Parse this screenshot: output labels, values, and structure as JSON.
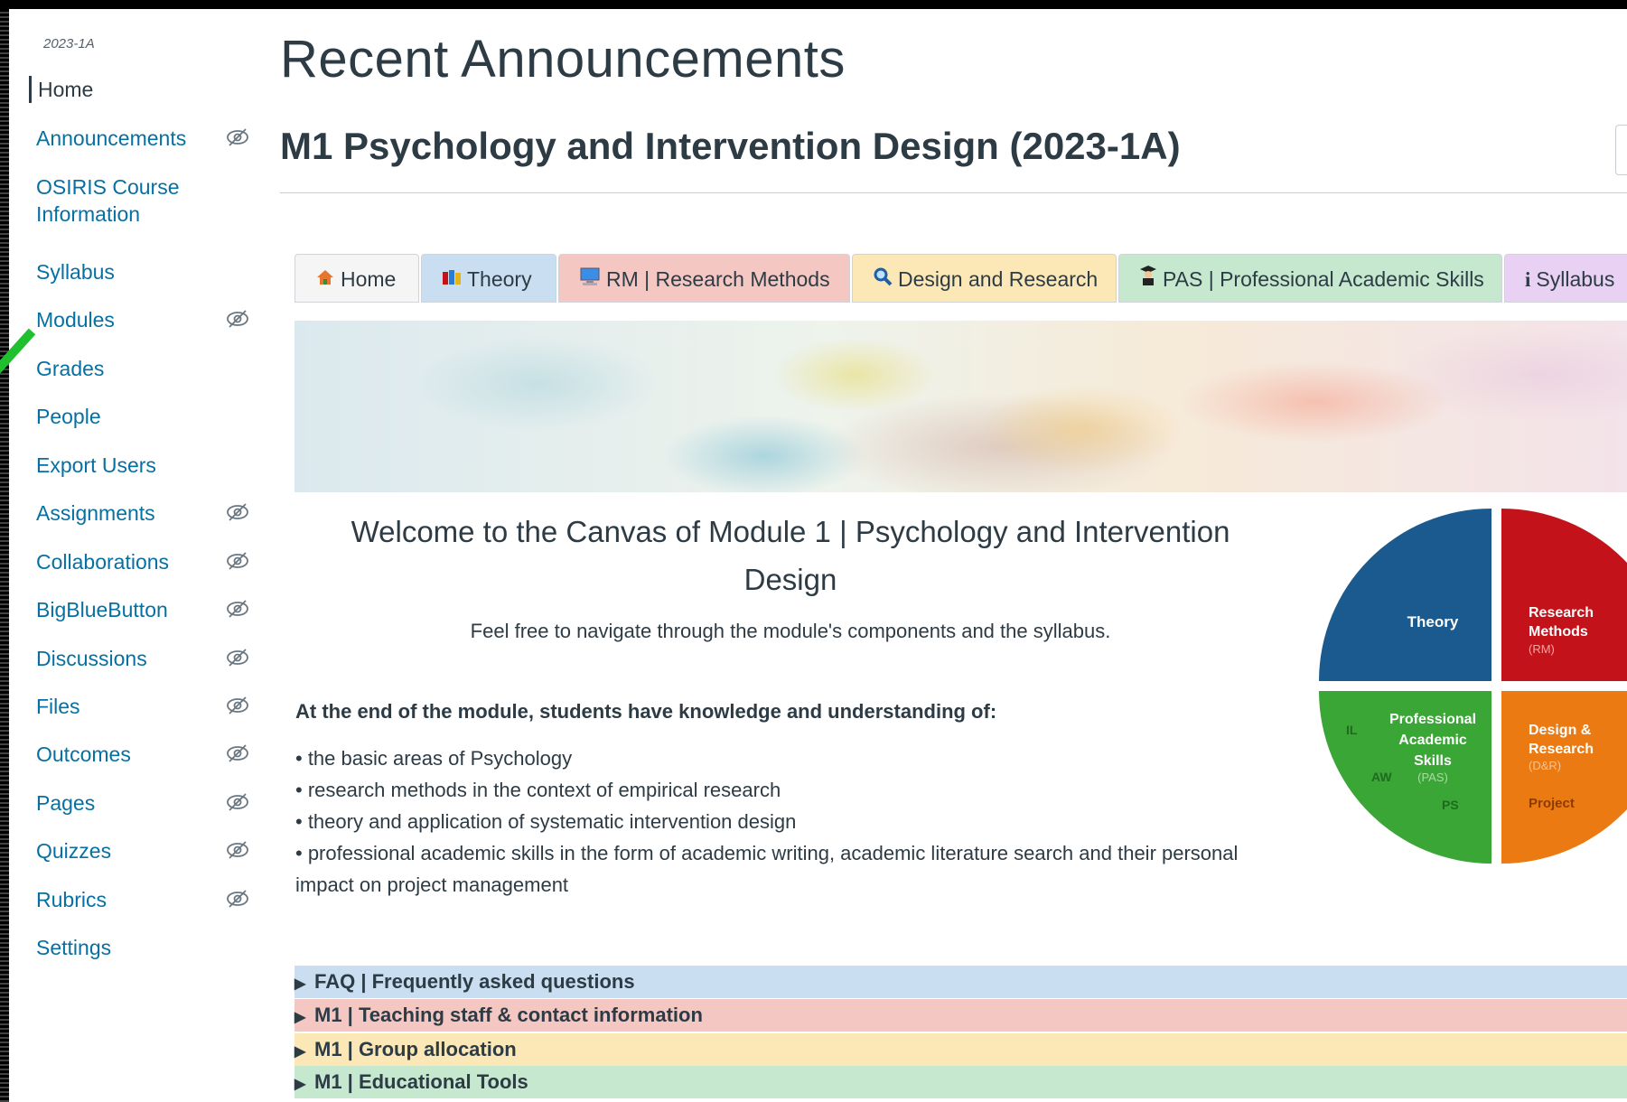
{
  "sidebar": {
    "term": "2023-1A",
    "items": [
      {
        "label": "Home",
        "hidden": false
      },
      {
        "label": "Announcements",
        "hidden": true
      },
      {
        "label": "OSIRIS Course",
        "label2": "Information",
        "hidden": false
      },
      {
        "label": "Syllabus",
        "hidden": false
      },
      {
        "label": "Modules",
        "hidden": true
      },
      {
        "label": "Grades",
        "hidden": false
      },
      {
        "label": "People",
        "hidden": false
      },
      {
        "label": "Export Users",
        "hidden": false
      },
      {
        "label": "Assignments",
        "hidden": true
      },
      {
        "label": "Collaborations",
        "hidden": true
      },
      {
        "label": "BigBlueButton",
        "hidden": true
      },
      {
        "label": "Discussions",
        "hidden": true
      },
      {
        "label": "Files",
        "hidden": true
      },
      {
        "label": "Outcomes",
        "hidden": true
      },
      {
        "label": "Pages",
        "hidden": true
      },
      {
        "label": "Quizzes",
        "hidden": true
      },
      {
        "label": "Rubrics",
        "hidden": true
      },
      {
        "label": "Settings",
        "hidden": false
      }
    ]
  },
  "header": {
    "page_title": "Recent Announcements",
    "course_title": "M1 Psychology and Intervention Design (2023-1A)"
  },
  "tabs": [
    {
      "label": "Home",
      "icon": "house-icon",
      "color": "#f5f5f5"
    },
    {
      "label": "Theory",
      "icon": "books-icon",
      "color": "#c9def0"
    },
    {
      "label": "RM | Research Methods",
      "icon": "computer-icon",
      "color": "#f4c7c3"
    },
    {
      "label": "Design and Research",
      "icon": "magnifier-icon",
      "color": "#fbe8b6"
    },
    {
      "label": "PAS | Professional Academic Skills",
      "icon": "graduate-icon",
      "color": "#c5e8cf"
    },
    {
      "label": "Syllabus",
      "icon": "info-icon",
      "color": "#e8d1f3"
    }
  ],
  "welcome": {
    "heading": "Welcome to the Canvas of Module 1 | Psychology and Intervention Design",
    "intro": "Feel free to navigate through the module's components and the syllabus.",
    "outcomes_heading": "At the end of the module, students have knowledge and understanding of:",
    "outcomes": [
      "• the basic areas of Psychology",
      "• research methods in the context of empirical research",
      "• theory and application of systematic intervention design",
      "• professional academic skills in the form of academic writing, academic literature search and their personal impact on project management"
    ]
  },
  "pie": {
    "theory": "Theory",
    "rm_line1": "Research",
    "rm_line2": "Methods",
    "rm_abbr": "(RM)",
    "pas_line1": "Professional",
    "pas_line2": "Academic",
    "pas_line3": "Skills",
    "pas_abbr": "(PAS)",
    "il": "IL",
    "aw": "AW",
    "ps": "PS",
    "dr_line1": "Design &",
    "dr_line2": "Research",
    "dr_abbr": "(D&R)",
    "project": "Project",
    "colors": {
      "theory": "#1b5a8e",
      "rm": "#c4121a",
      "pas": "#3aa636",
      "dr": "#ec7a12"
    }
  },
  "collapsibles": [
    {
      "label": "FAQ | Frequently asked questions",
      "color": "#c9def0"
    },
    {
      "label": "M1 | Teaching staff & contact information",
      "color": "#f4c7c3"
    },
    {
      "label": "M1 | Group allocation",
      "color": "#fbe8b6"
    },
    {
      "label": "M1 | Educational Tools",
      "color": "#c5e8cf"
    }
  ]
}
